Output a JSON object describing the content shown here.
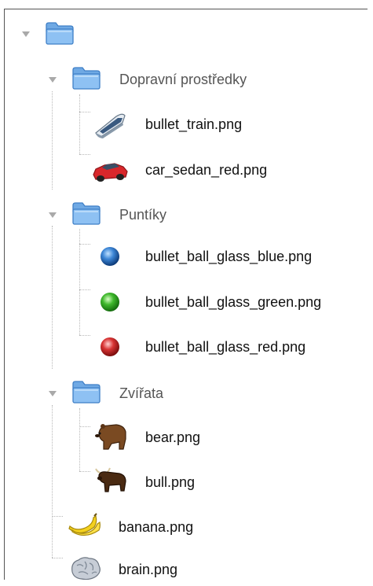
{
  "tree": {
    "root": {
      "name": "",
      "expanded": true
    },
    "folders": [
      {
        "name": "Dopravní prostředky",
        "expanded": true,
        "files": [
          {
            "name": "bullet_train.png",
            "icon": "bullet-train-icon"
          },
          {
            "name": "car_sedan_red.png",
            "icon": "red-car-icon"
          }
        ]
      },
      {
        "name": "Puntíky",
        "expanded": true,
        "files": [
          {
            "name": "bullet_ball_glass_blue.png",
            "icon": "blue-ball-icon"
          },
          {
            "name": "bullet_ball_glass_green.png",
            "icon": "green-ball-icon"
          },
          {
            "name": "bullet_ball_glass_red.png",
            "icon": "red-ball-icon"
          }
        ]
      },
      {
        "name": "Zvířata",
        "expanded": true,
        "files": [
          {
            "name": "bear.png",
            "icon": "bear-icon"
          },
          {
            "name": "bull.png",
            "icon": "bull-icon"
          }
        ]
      }
    ],
    "files": [
      {
        "name": "banana.png",
        "icon": "banana-icon"
      },
      {
        "name": "brain.png",
        "icon": "brain-icon"
      }
    ]
  },
  "colors": {
    "folder_fill": "#8ec1f3",
    "folder_border": "#3f7fc6",
    "toggle_arrow": "#a9a9a9",
    "folder_label": "#555555",
    "file_label": "#111111",
    "connector": "#b8b8b8"
  }
}
